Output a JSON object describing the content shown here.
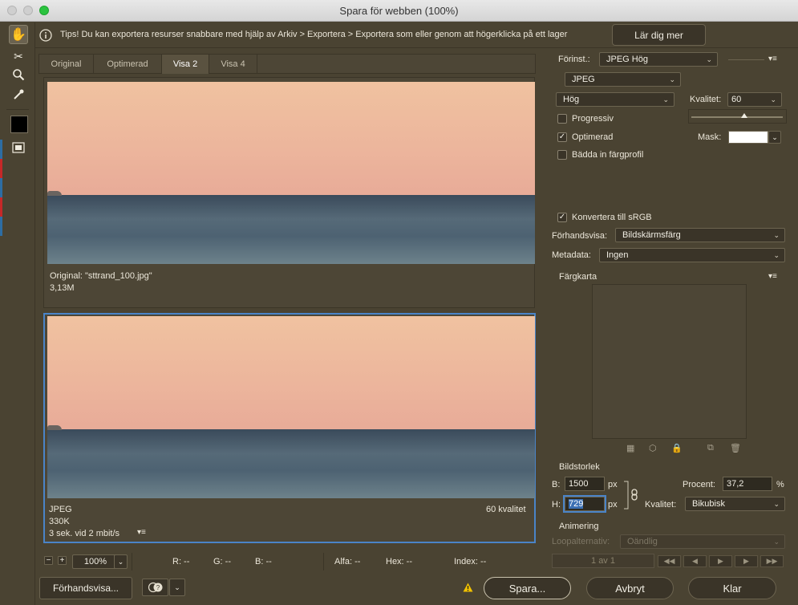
{
  "window": {
    "title": "Spara för webben (100%)"
  },
  "tip": {
    "text": "Tips! Du kan exportera resurser snabbare med hjälp av Arkiv > Exportera > Exportera som eller genom att högerklicka på ett lager",
    "learn_more": "Lär dig mer"
  },
  "tabs": [
    "Original",
    "Optimerad",
    "Visa 2",
    "Visa 4"
  ],
  "original_panel": {
    "name": "Original: \"sttrand_100.jpg\"",
    "size": "3,13M"
  },
  "optimized_panel": {
    "format": "JPEG",
    "size": "330K",
    "time": "3 sek. vid 2 mbit/s",
    "quality": "60 kvalitet"
  },
  "status": {
    "zoom": "100%",
    "r": "R: --",
    "g": "G: --",
    "b": "B: --",
    "alpha": "Alfa: --",
    "hex": "Hex: --",
    "index": "Index: --"
  },
  "bottom": {
    "preview": "Förhandsvisa...",
    "save": "Spara...",
    "cancel": "Avbryt",
    "done": "Klar"
  },
  "settings": {
    "preset_label": "Förinst.:",
    "preset_value": "JPEG Hög",
    "format": "JPEG",
    "quality_level": "Hög",
    "quality_label": "Kvalitet:",
    "quality_value": "60",
    "progressive": "Progressiv",
    "optimized": "Optimerad",
    "mask_label": "Mask:",
    "embed_profile": "Bädda in färgprofil",
    "convert_srgb": "Konvertera till sRGB",
    "preview_label": "Förhandsvisa:",
    "preview_value": "Bildskärmsfärg",
    "metadata_label": "Metadata:",
    "metadata_value": "Ingen",
    "color_table": "Färgkarta"
  },
  "image_size": {
    "title": "Bildstorlek",
    "w_label": "B:",
    "w_value": "1500",
    "w_unit": "px",
    "h_label": "H:",
    "h_value": "729",
    "h_unit": "px",
    "percent_label": "Procent:",
    "percent_value": "37,2",
    "percent_unit": "%",
    "quality_label": "Kvalitet:",
    "quality_value": "Bikubisk"
  },
  "animation": {
    "title": "Animering",
    "loop_label": "Loopalternativ:",
    "loop_value": "Oändlig",
    "frame": "1 av 1"
  }
}
